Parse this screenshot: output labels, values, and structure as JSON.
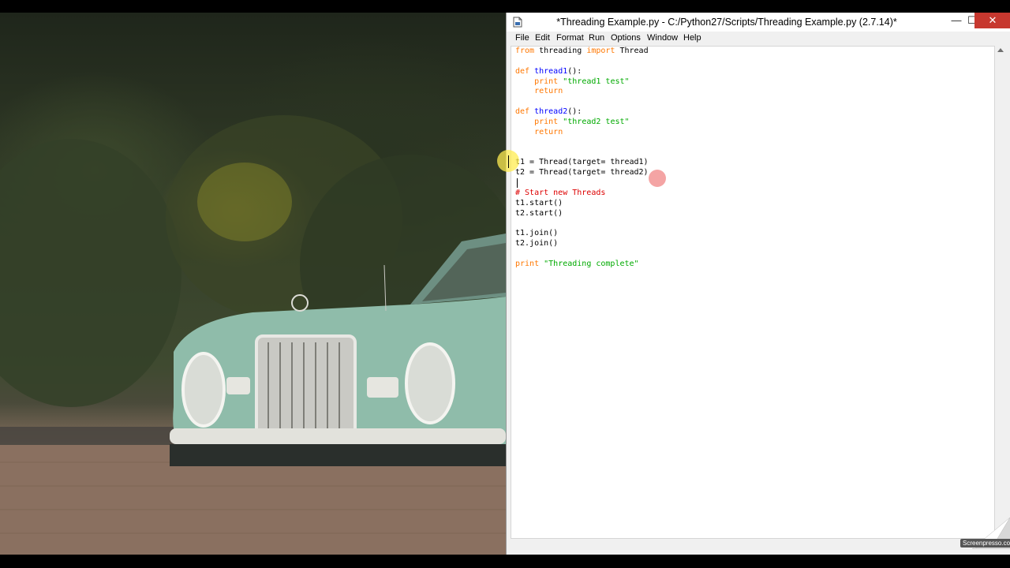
{
  "window": {
    "title": "*Threading Example.py - C:/Python27/Scripts/Threading Example.py (2.7.14)*",
    "minimize_glyph": "—",
    "maximize_glyph": "☐",
    "close_glyph": "✕"
  },
  "menu": {
    "items": [
      "File",
      "Edit",
      "Format",
      "Run",
      "Options",
      "Window",
      "Help"
    ]
  },
  "editor": {
    "lines": [
      [
        {
          "t": "from",
          "c": "kw"
        },
        {
          "t": " threading ",
          "c": ""
        },
        {
          "t": "import",
          "c": "kw"
        },
        {
          "t": " Thread",
          "c": ""
        }
      ],
      [],
      [
        {
          "t": "def",
          "c": "kw"
        },
        {
          "t": " ",
          "c": ""
        },
        {
          "t": "thread1",
          "c": "fn"
        },
        {
          "t": "():",
          "c": ""
        }
      ],
      [
        {
          "t": "    ",
          "c": ""
        },
        {
          "t": "print",
          "c": "kw"
        },
        {
          "t": " ",
          "c": ""
        },
        {
          "t": "\"thread1 test\"",
          "c": "str"
        }
      ],
      [
        {
          "t": "    ",
          "c": ""
        },
        {
          "t": "return",
          "c": "kw"
        }
      ],
      [],
      [
        {
          "t": "def",
          "c": "kw"
        },
        {
          "t": " ",
          "c": ""
        },
        {
          "t": "thread2",
          "c": "fn"
        },
        {
          "t": "():",
          "c": ""
        }
      ],
      [
        {
          "t": "    ",
          "c": ""
        },
        {
          "t": "print",
          "c": "kw"
        },
        {
          "t": " ",
          "c": ""
        },
        {
          "t": "\"thread2 test\"",
          "c": "str"
        }
      ],
      [
        {
          "t": "    ",
          "c": ""
        },
        {
          "t": "return",
          "c": "kw"
        }
      ],
      [],
      [],
      [
        {
          "t": "t1 = Thread(target= thread1)",
          "c": ""
        }
      ],
      [
        {
          "t": "t2 = Thread(target= thread2)",
          "c": ""
        }
      ],
      [],
      [
        {
          "t": "# Start new Threads",
          "c": "cm"
        }
      ],
      [
        {
          "t": "t1.start()",
          "c": ""
        }
      ],
      [
        {
          "t": "t2.start()",
          "c": ""
        }
      ],
      [],
      [
        {
          "t": "t1.join()",
          "c": ""
        }
      ],
      [
        {
          "t": "t2.join()",
          "c": ""
        }
      ],
      [],
      [
        {
          "t": "print",
          "c": "kw"
        },
        {
          "t": " ",
          "c": ""
        },
        {
          "t": "\"Threading complete\"",
          "c": "str"
        }
      ]
    ]
  },
  "watermark": {
    "text": "Screenpresso.com"
  },
  "colors": {
    "keyword": "#ff7700",
    "function_name": "#0000ff",
    "string": "#00aa00",
    "comment": "#dd0000",
    "close_button": "#c7382f"
  },
  "icons": {
    "app": "idle-file-icon",
    "scroll_up": "triangle-up-icon"
  }
}
